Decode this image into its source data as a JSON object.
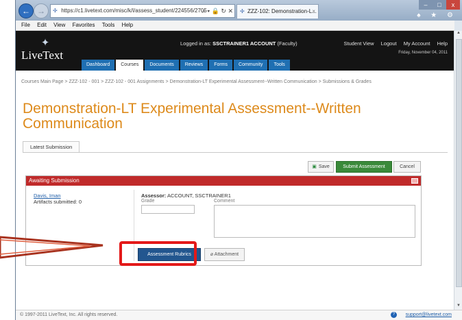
{
  "browser": {
    "url": "https://c1.livetext.com/misc/k/l/assess_student/224556/2705",
    "tab_title": "ZZZ-102: Demonstration-L...",
    "menu": [
      "File",
      "Edit",
      "View",
      "Favorites",
      "Tools",
      "Help"
    ],
    "win_min": "–",
    "win_max": "□",
    "win_close": "x",
    "chrome_icons": "♠ ★ ⚙",
    "back_icon": "←",
    "forward_icon": "→"
  },
  "header": {
    "logo_text": "LiveText",
    "logged_prefix": "Logged in as:",
    "logged_user": "SSCTRAINER1 ACCOUNT",
    "logged_role": "(Faculty)",
    "links": [
      "Student View",
      "Logout",
      "My Account",
      "Help"
    ],
    "date": "Friday, November 04, 2011",
    "tabs": [
      {
        "label": "Dashboard",
        "active": false
      },
      {
        "label": "Courses",
        "active": true
      },
      {
        "label": "Documents",
        "active": false
      },
      {
        "label": "Reviews",
        "active": false
      },
      {
        "label": "Forms",
        "active": false
      },
      {
        "label": "Community",
        "active": false
      },
      {
        "label": "Tools",
        "active": false
      }
    ]
  },
  "breadcrumb": "Courses Main Page > ZZZ-102 - 001 > ZZZ-102 - 001 Assignments > Demonstration-LT Experimental Assessment--Written Communication > Submissions & Grades",
  "page_title": "Demonstration-LT Experimental Assessment--Written Communication",
  "sub_tab": "Latest Submission",
  "actions": {
    "save": "Save",
    "submit": "Submit Assessment",
    "cancel": "Cancel"
  },
  "panel": {
    "header": "Awaiting Submission",
    "student_name": "Davis, Iman",
    "artifacts": "Artifacts submitted: 0",
    "assessor_label": "Assessor:",
    "assessor_name": "ACCOUNT, SSCTRAINER1",
    "grade_label": "Grade",
    "comment_label": "Comment",
    "grade_value": "",
    "comment_value": "",
    "rubrics_button": "Assessment Rubrics",
    "attachment_button": "Attachment"
  },
  "footer": {
    "copyright": "© 1997-2011 LiveText, Inc. All rights reserved.",
    "support": "support@livetext.com"
  },
  "colors": {
    "accent": "#dd8a1b",
    "panel_header": "#c02a2a",
    "tab_blue": "#1f6fb2",
    "callout": "#e31919"
  }
}
